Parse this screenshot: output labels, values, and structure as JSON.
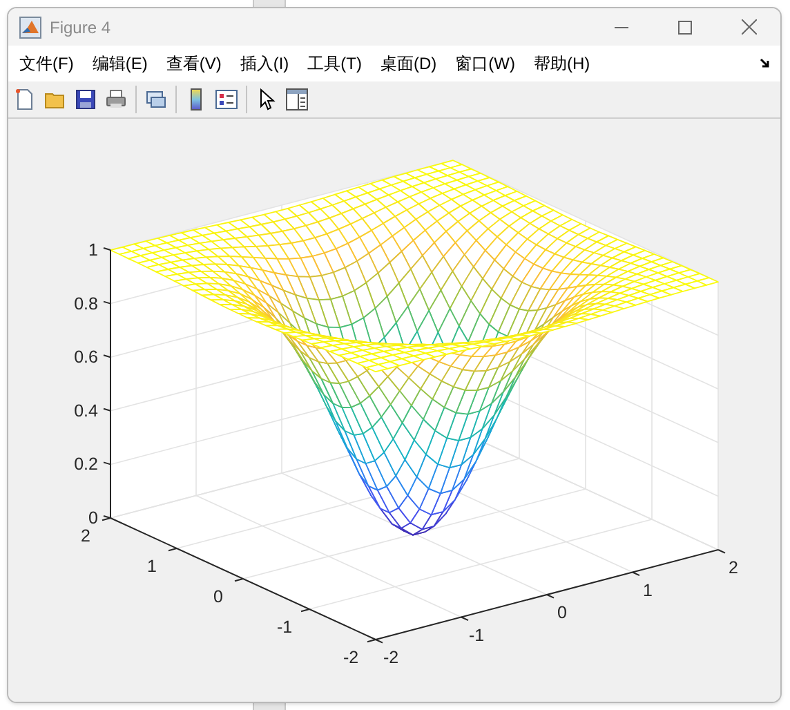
{
  "window": {
    "title": "Figure 4"
  },
  "menu": [
    {
      "label": "文件(F)"
    },
    {
      "label": "编辑(E)"
    },
    {
      "label": "查看(V)"
    },
    {
      "label": "插入(I)"
    },
    {
      "label": "工具(T)"
    },
    {
      "label": "桌面(D)"
    },
    {
      "label": "窗口(W)"
    },
    {
      "label": "帮助(H)"
    }
  ],
  "figure": {
    "z_ticks": [
      "1",
      "0.8",
      "0.6",
      "0.4",
      "0.2",
      "0"
    ],
    "y_ticks": [
      "2",
      "1",
      "0",
      "-1",
      "-2"
    ],
    "x_ticks": [
      "-2",
      "-1",
      "0",
      "1",
      "2"
    ]
  }
}
